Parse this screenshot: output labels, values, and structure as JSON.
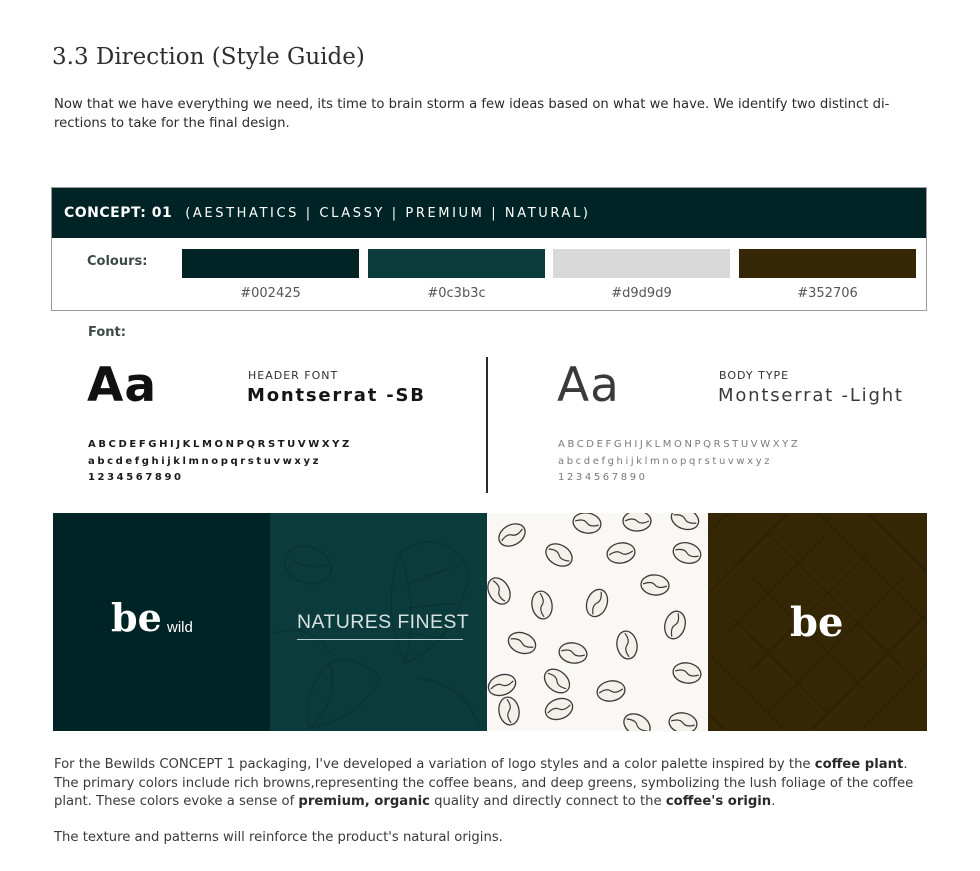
{
  "heading": "3.3 Direction (Style Guide)",
  "intro": "Now that we have everything we need, its time to brain storm a few ideas based on what we have. We identify two distinct di-rections to take for the final design.",
  "concept": {
    "number": "CONCEPT: 01",
    "tags": "(AESTHATICS | CLASSY | PREMIUM | NATURAL)",
    "colours_label": "Colours:",
    "swatches": [
      {
        "hex": "#002425",
        "label": "#002425"
      },
      {
        "hex": "#0c3b3c",
        "label": "#0c3b3c"
      },
      {
        "hex": "#d9d9d9",
        "label": "#d9d9d9"
      },
      {
        "hex": "#352706",
        "label": "#352706"
      }
    ]
  },
  "font_label": "Font:",
  "fonts": {
    "header": {
      "sample": "Aa",
      "kind": "HEADER FONT",
      "name": "Montserrat -SB",
      "upper": "ABCDEFGHIJKLMONPQRSTUVWXYZ",
      "lower": "abcdefghijklmnopqrstuvwxyz",
      "digits": "1234567890"
    },
    "body": {
      "sample": "Aa",
      "kind": "BODY TYPE",
      "name": "Montserrat -Light",
      "upper": "ABCDEFGHIJKLMONPQRSTUVWXYZ",
      "lower": "abcdefghijklmnopqrstuvwxyz",
      "digits": "1234567890"
    }
  },
  "tiles": {
    "logo1_mark": "be",
    "logo1_word": "wild",
    "natures": "NATURES FINEST",
    "logo4_mark": "be"
  },
  "outro": {
    "p1_a": "For the Bewilds CONCEPT 1 packaging, I've developed a variation of logo styles and a color palette inspired by the ",
    "p1_b": "coffee plant",
    "p1_c": ". The primary colors include rich browns,representing the coffee beans, and deep greens, symbolizing the lush foliage of the coffee plant. These colors evoke a sense of ",
    "p1_d": "premium, organic",
    "p1_e": " quality and directly connect to the ",
    "p1_f": "coffee's origin",
    "p1_g": ".",
    "p2": "The texture and patterns will reinforce the product's natural origins."
  }
}
